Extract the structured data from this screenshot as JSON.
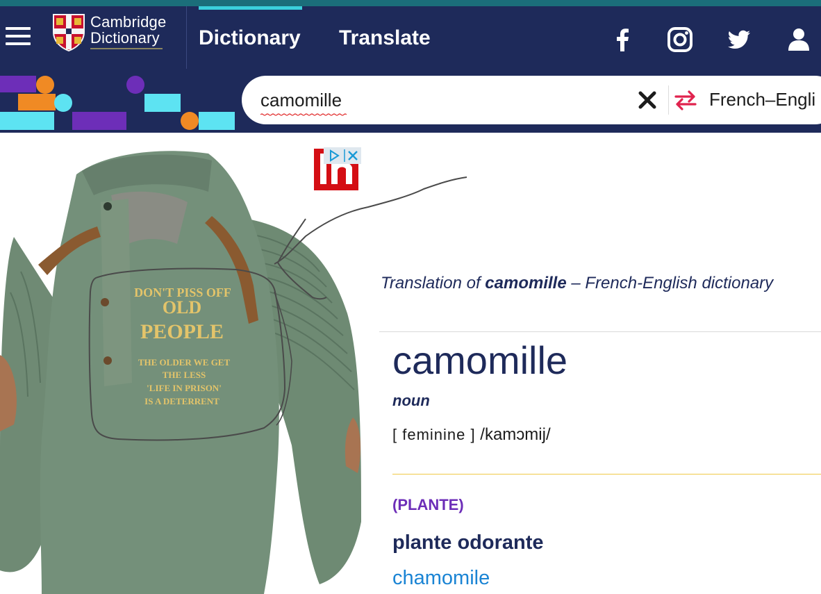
{
  "header": {
    "logo_line1": "Cambridge",
    "logo_line2": "Dictionary",
    "nav": {
      "dictionary": "Dictionary",
      "translate": "Translate"
    },
    "social_icons": [
      "facebook-icon",
      "instagram-icon",
      "twitter-icon",
      "user-icon"
    ]
  },
  "search": {
    "value": "camomille",
    "language": "French–Engli"
  },
  "ad": {
    "shirt_text": [
      "DON'T PISS OFF",
      "OLD",
      "PEOPLE",
      "THE OLDER WE GET",
      "THE LESS",
      "'LIFE IN PRISON'",
      "IS A DETERRENT"
    ]
  },
  "entry": {
    "title_prefix": "Translation of ",
    "title_word": "camomille",
    "title_suffix": " – French-English dictionary",
    "headword": "camomille",
    "pos": "noun",
    "grammar": "[ feminine ]",
    "pronunciation": "/kamɔmij/",
    "domain": "(PLANTE)",
    "definition": "plante odorante",
    "translation": "chamomile"
  },
  "colors": {
    "navy": "#1e2a5a",
    "accent_teal": "#3bd0dc",
    "purple": "#6d2eb8",
    "link_blue": "#1a84d4",
    "swap_red": "#e0234e",
    "shirt_green": "#6f8a74"
  }
}
